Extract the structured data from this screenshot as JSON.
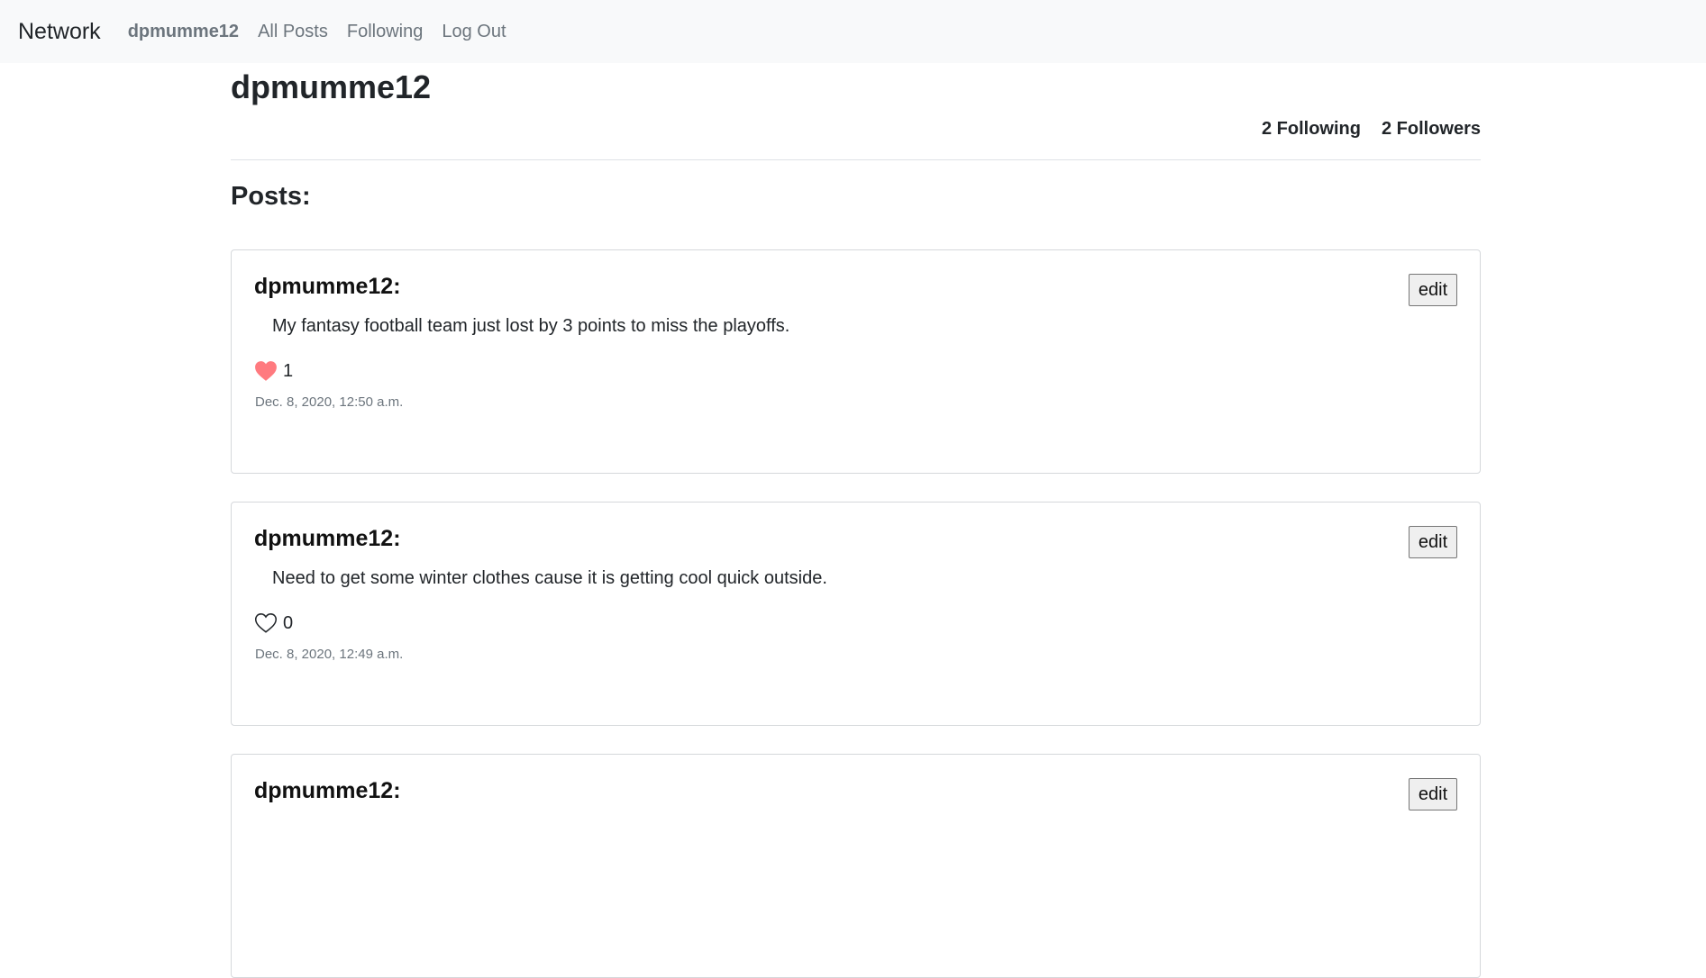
{
  "nav": {
    "brand": "Network",
    "user": "dpmumme12",
    "all_posts": "All Posts",
    "following": "Following",
    "logout": "Log Out"
  },
  "profile": {
    "username": "dpmumme12",
    "following_count": "2 Following",
    "followers_count": "2 Followers"
  },
  "posts_heading": "Posts:",
  "posts": [
    {
      "author": "dpmumme12:",
      "edit_label": "edit",
      "content": "My fantasy football team just lost by 3 points to miss the playoffs.",
      "likes": "1",
      "liked": true,
      "timestamp": "Dec. 8, 2020, 12:50 a.m."
    },
    {
      "author": "dpmumme12:",
      "edit_label": "edit",
      "content": "Need to get some winter clothes cause it is getting cool quick outside.",
      "likes": "0",
      "liked": false,
      "timestamp": "Dec. 8, 2020, 12:49 a.m."
    },
    {
      "author": "dpmumme12:",
      "edit_label": "edit"
    }
  ],
  "colors": {
    "navbar_bg": "#f8f9fa",
    "heart_filled": "#ff7a7f",
    "muted": "#6c757d"
  },
  "icons": {
    "liked": "heart-filled-icon",
    "unliked": "heart-outline-icon"
  }
}
